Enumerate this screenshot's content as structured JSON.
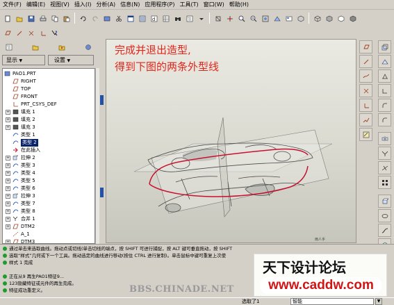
{
  "menubar": [
    "文件(F)",
    "编辑(E)",
    "视图(V)",
    "插入(I)",
    "分析(A)",
    "信息(N)",
    "应用程序(P)",
    "工具(T)",
    "窗口(W)",
    "帮助(H)"
  ],
  "panel": {
    "show_label": "显示",
    "settings_label": "设置",
    "caret": "▼"
  },
  "tree": {
    "items": [
      {
        "label": "PAO1.PRT",
        "icon": "part-icon",
        "indent": 0,
        "expand": false
      },
      {
        "label": "RIGHT",
        "icon": "datum-plane-icon",
        "indent": 1,
        "expand": false
      },
      {
        "label": "TOP",
        "icon": "datum-plane-icon",
        "indent": 1,
        "expand": false
      },
      {
        "label": "FRONT",
        "icon": "datum-plane-icon",
        "indent": 1,
        "expand": false
      },
      {
        "label": "PRT_CSYS_DEF",
        "icon": "coordinate-system-icon",
        "indent": 1,
        "expand": false
      },
      {
        "label": "填充 1",
        "icon": "fill-icon",
        "indent": 1,
        "expand": true
      },
      {
        "label": "填充 2",
        "icon": "fill-icon",
        "indent": 1,
        "expand": true
      },
      {
        "label": "填充 3",
        "icon": "fill-icon",
        "indent": 1,
        "expand": true
      },
      {
        "label": "类型 1",
        "icon": "style-icon",
        "indent": 1,
        "expand": false
      },
      {
        "label": "类型 2",
        "icon": "style-icon",
        "indent": 1,
        "expand": false,
        "selected": true
      },
      {
        "label": "在此插入",
        "icon": "insert-here-icon",
        "indent": 1,
        "expand": false
      },
      {
        "label": "拉伸 2",
        "icon": "extrude-icon",
        "indent": 1,
        "expand": true
      },
      {
        "label": "类型 3",
        "icon": "style-icon",
        "indent": 1,
        "expand": true
      },
      {
        "label": "类型 4",
        "icon": "style-icon",
        "indent": 1,
        "expand": true
      },
      {
        "label": "类型 5",
        "icon": "style-icon",
        "indent": 1,
        "expand": true
      },
      {
        "label": "类型 6",
        "icon": "style-icon",
        "indent": 1,
        "expand": true
      },
      {
        "label": "拉伸 3",
        "icon": "extrude-icon",
        "indent": 1,
        "expand": true
      },
      {
        "label": "类型 7",
        "icon": "style-icon",
        "indent": 1,
        "expand": true
      },
      {
        "label": "类型 8",
        "icon": "style-icon",
        "indent": 1,
        "expand": true
      },
      {
        "label": "合并 1",
        "icon": "merge-icon",
        "indent": 1,
        "expand": true
      },
      {
        "label": "DTM2",
        "icon": "datum-plane-icon",
        "indent": 1,
        "expand": true
      },
      {
        "label": "A_1",
        "icon": "axis-icon",
        "indent": 1,
        "expand": false
      },
      {
        "label": "DTM3",
        "icon": "datum-plane-icon",
        "indent": 1,
        "expand": true
      }
    ]
  },
  "graphics": {
    "annotation_line1": "完成并退出造型,",
    "annotation_line2": "得到下图的两条外型线",
    "small_label": "雨人手"
  },
  "messages": [
    {
      "text": "通过单击来选取曲线。拖动点或切线(单击切线的端点，按 SHIFT 可进行捕捉，按 ALT 键可垂直拖动，按 SHIFT",
      "icon": "info"
    },
    {
      "text": "选取“样式”几何或下一个工具。拖动选定的曲线进行移动(按住 CTRL 进行复制)。单击鼠标中键可重复上次使",
      "icon": "info"
    },
    {
      "text": "样式 1 完成",
      "icon": "info"
    },
    {
      "text": "正在从9 再生PAO1特征9...",
      "icon": "info"
    },
    {
      "text": "123隐藏特征或元件的再生完成。",
      "icon": "info"
    },
    {
      "text": "特征成功重定义。",
      "icon": "info"
    }
  ],
  "watermark": {
    "url": "BBS.CHINADE.NET",
    "logo_title": "天下设计论坛",
    "logo_url": "www.caddw.com"
  },
  "status": {
    "selected_label": "选取了1",
    "filter_value": "智能"
  },
  "colors": {
    "annotation": "#e3261c",
    "chrome": "#d4d0c8",
    "curve": "#c8102e",
    "selection": "#0a246a"
  }
}
